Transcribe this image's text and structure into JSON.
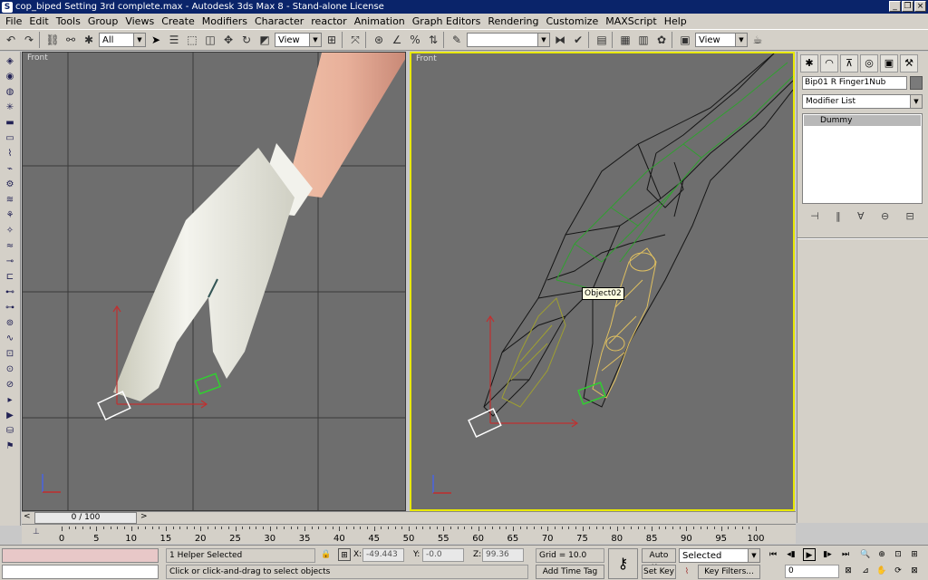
{
  "window": {
    "title": "cop_biped Setting 3rd complete.max - Autodesk 3ds Max 8 - Stand-alone License",
    "buttons": {
      "minimize": "_",
      "restore": "❐",
      "close": "×"
    }
  },
  "menu": [
    "File",
    "Edit",
    "Tools",
    "Group",
    "Views",
    "Create",
    "Modifiers",
    "Character",
    "reactor",
    "Animation",
    "Graph Editors",
    "Rendering",
    "Customize",
    "MAXScript",
    "Help"
  ],
  "toolbar": {
    "selection_filter": "All",
    "ref_coord": "View",
    "named_selection": "",
    "render_view": "View"
  },
  "viewports": {
    "left": {
      "label": "Front"
    },
    "right": {
      "label": "Front",
      "tooltip": "Object02"
    }
  },
  "command_panel": {
    "object_name": "Bip01 R Finger1Nub",
    "modifier_list": "Modifier List",
    "stack_item": "Dummy"
  },
  "timeline": {
    "slider": "0 / 100",
    "prev": "<",
    "next": ">",
    "ticks": [
      "0",
      "5",
      "10",
      "15",
      "20",
      "25",
      "30",
      "35",
      "40",
      "45",
      "50",
      "55",
      "60",
      "65",
      "70",
      "75",
      "80",
      "85",
      "90",
      "95",
      "100"
    ]
  },
  "status": {
    "selection": "1 Helper Selected",
    "prompt": "Click or click-and-drag to select objects",
    "x_label": "X:",
    "x_value": "-49.443",
    "y_label": "Y:",
    "y_value": "-0.0",
    "z_label": "Z:",
    "z_value": "99.36",
    "grid": "Grid = 10.0",
    "add_time_tag": "Add Time Tag",
    "auto_key": "Auto Key",
    "set_key": "Set Key",
    "key_mode": "Selected",
    "key_filters": "Key Filters...",
    "frame": "0"
  }
}
